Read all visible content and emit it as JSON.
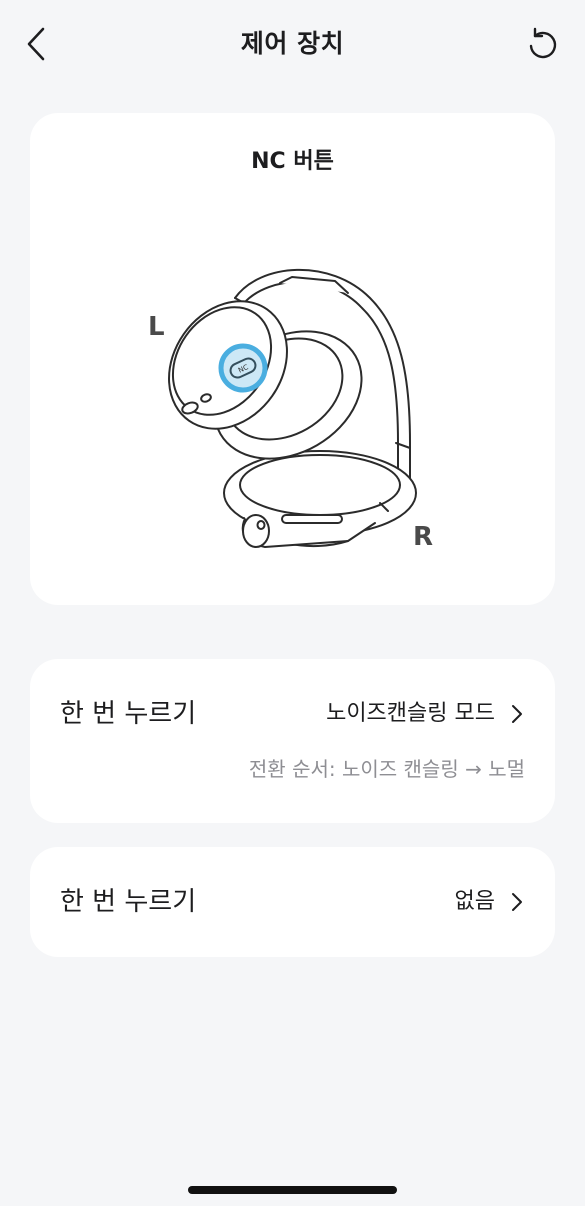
{
  "header": {
    "title": "제어 장치",
    "back_icon": "chevron-left-icon",
    "reset_icon": "reset-icon"
  },
  "hero": {
    "title": "NC 버튼",
    "left_label": "L",
    "right_label": "R",
    "button_label": "NC",
    "highlight_color": "#4aaee0"
  },
  "settings": [
    {
      "label": "한 번 누르기",
      "value": "노이즈캔슬링 모드",
      "sub": "전환 순서: 노이즈 캔슬링 → 노멀"
    },
    {
      "label": "한 번 누르기",
      "value": "없음"
    }
  ]
}
